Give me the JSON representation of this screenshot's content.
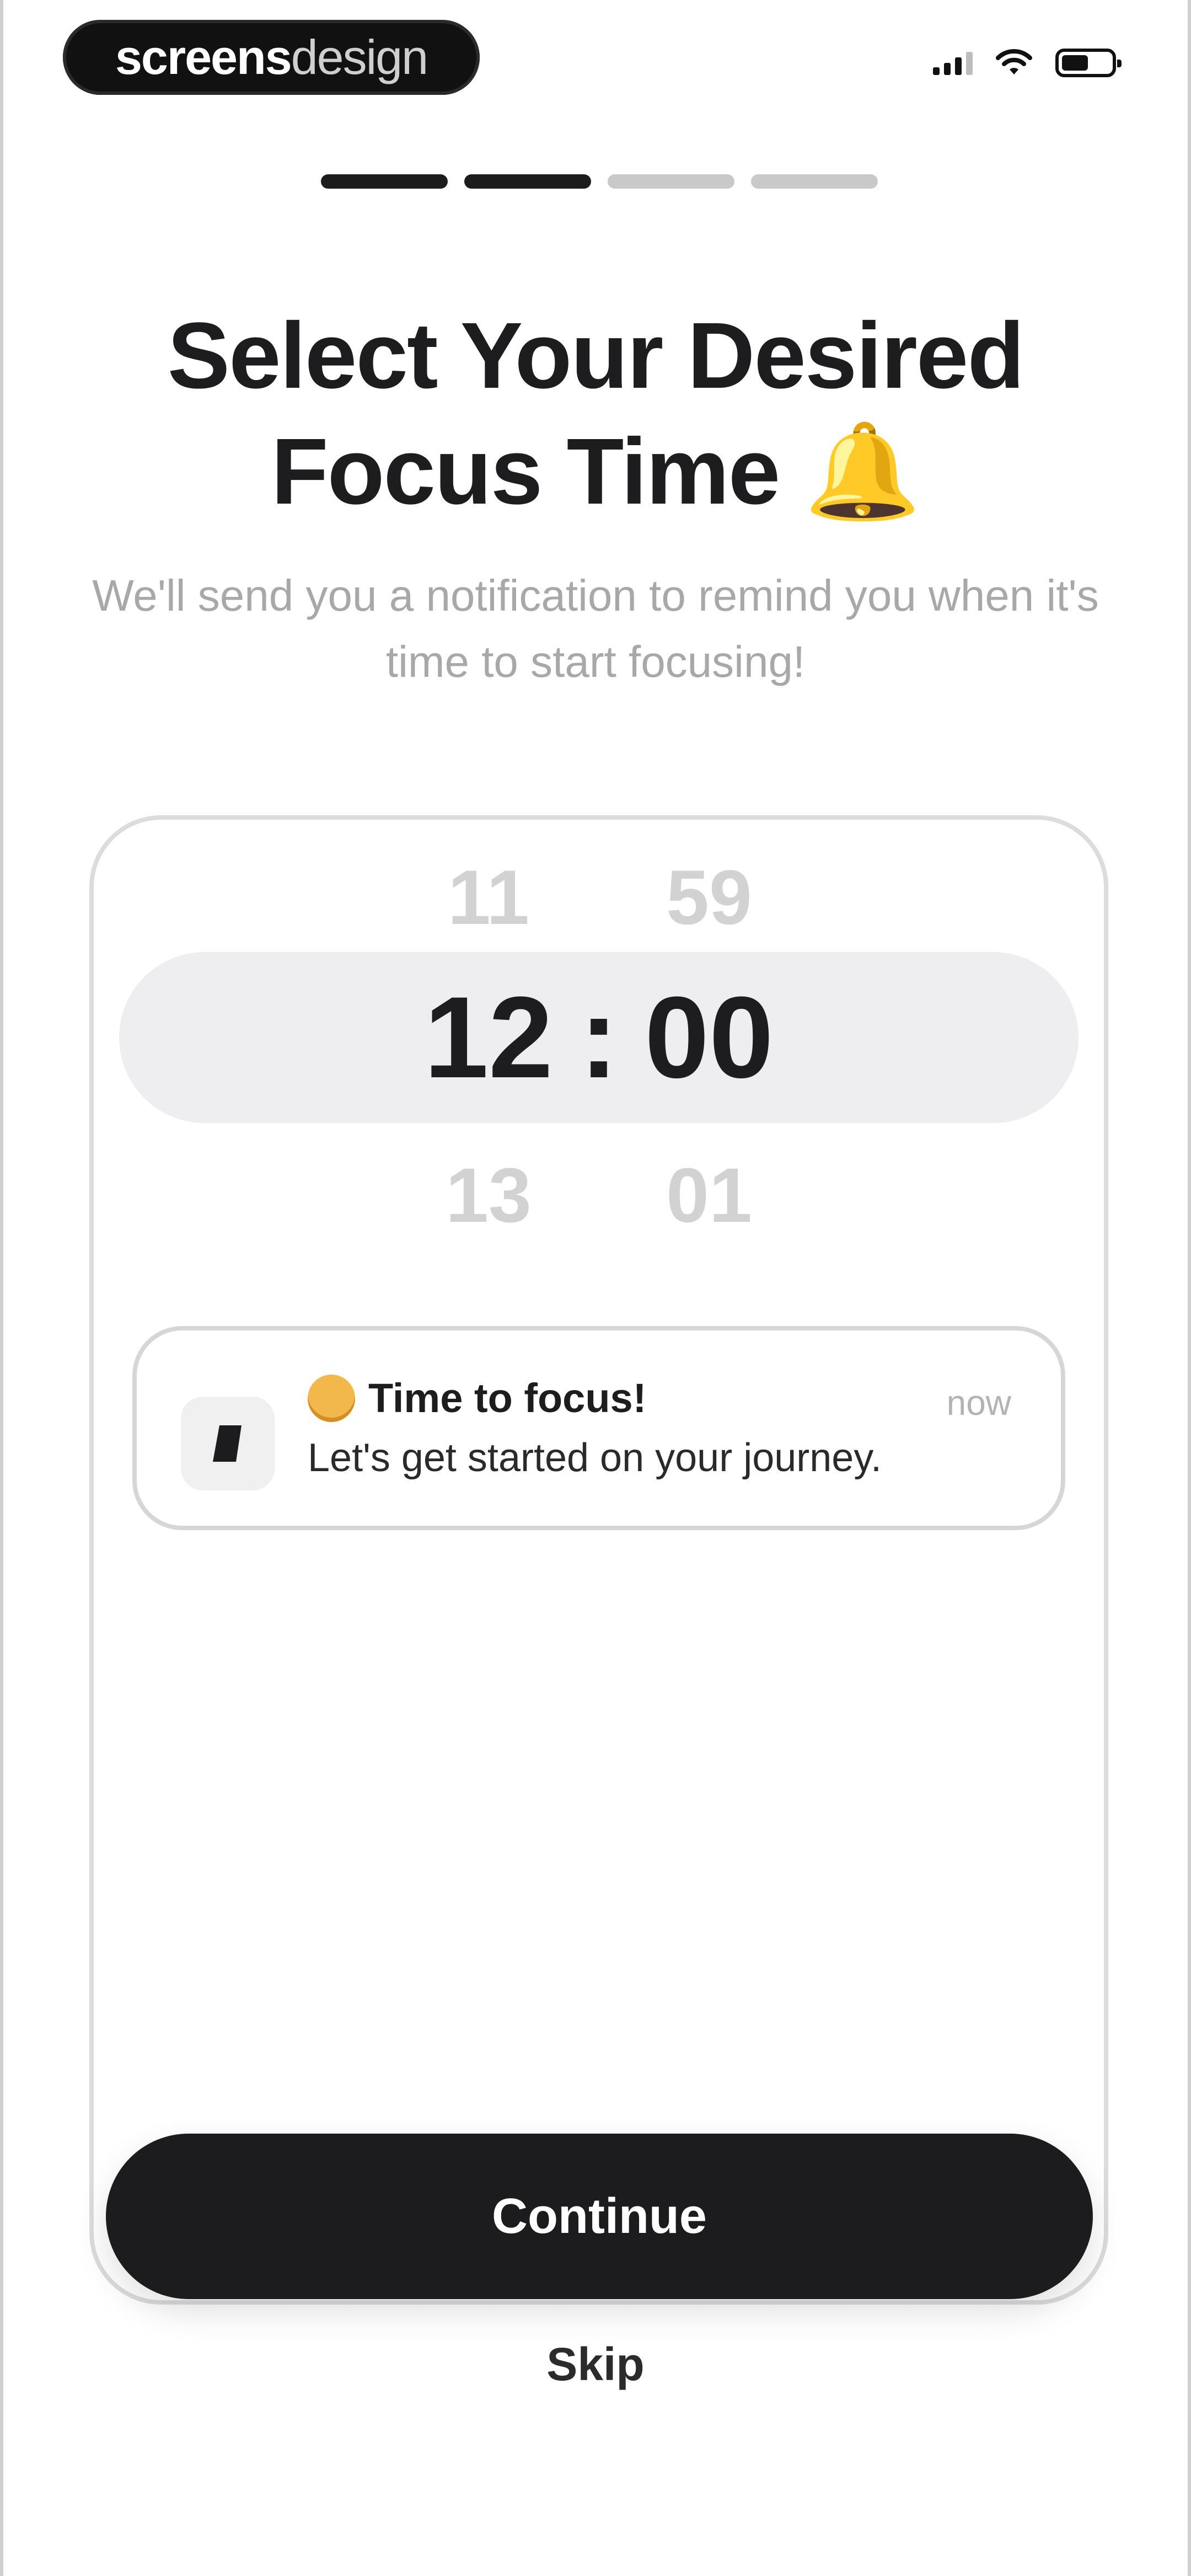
{
  "status_bar": {
    "brand_part1": "screens",
    "brand_part2": "design",
    "battery_level": 0.55
  },
  "progress": {
    "total_steps": 4,
    "current_step": 2
  },
  "header": {
    "title": "Select Your Desired Focus Time 🔔",
    "subtitle": "We'll send you a notification to remind you when it's time to start focusing!"
  },
  "time_picker": {
    "above": {
      "hour": "11",
      "minute": "59"
    },
    "selected": {
      "hour": "12",
      "separator": ":",
      "minute": "00"
    },
    "below": {
      "hour": "13",
      "minute": "01"
    }
  },
  "notification": {
    "title": "Time to focus!",
    "body": "Let's get started on your journey.",
    "time": "now"
  },
  "actions": {
    "continue_label": "Continue",
    "skip_label": "Skip"
  },
  "colors": {
    "primary": "#1c1c1e",
    "muted_text": "#a8a8a8",
    "selection_band": "#eeeef0"
  }
}
